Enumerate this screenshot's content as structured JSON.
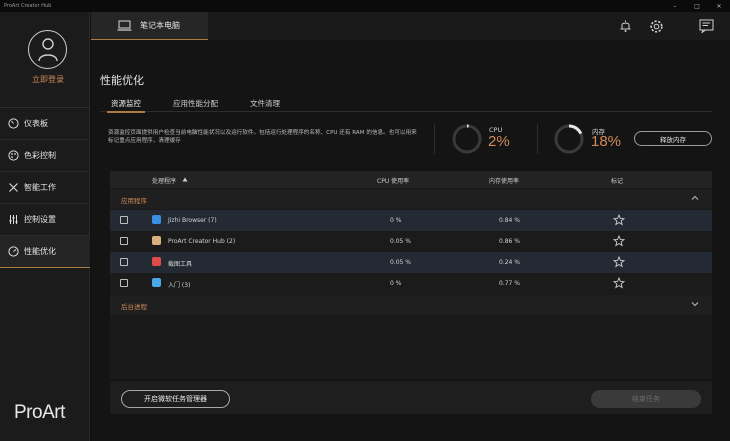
{
  "window": {
    "title": "ProArt Creator Hub",
    "controls": [
      "–",
      "□",
      "✕"
    ]
  },
  "sidebar": {
    "login_label": "立即登录",
    "items": [
      {
        "label": "仪表板",
        "icon": "gauge-icon"
      },
      {
        "label": "色彩控制",
        "icon": "palette-icon"
      },
      {
        "label": "智能工作",
        "icon": "tools-icon"
      },
      {
        "label": "控制设置",
        "icon": "sliders-icon"
      },
      {
        "label": "性能优化",
        "icon": "performance-icon",
        "active": true
      }
    ],
    "brand": "ProArt"
  },
  "header": {
    "device_tab": "笔记本电脑",
    "icons": [
      "bell-icon",
      "gear-icon",
      "feedback-icon"
    ]
  },
  "page": {
    "title": "性能优化",
    "tabs": [
      {
        "label": "资源监控",
        "active": true
      },
      {
        "label": "应用性能分配",
        "active": false
      },
      {
        "label": "文件清理",
        "active": false
      }
    ],
    "description": "资源监控页面提供用户检查当前电脑性能状况以及运行软件。包括运行处理程序的名称、CPU 还有 RAM 的信息。也可以用来标记重点应用程序，清理缓存"
  },
  "monitor": {
    "cpu": {
      "label": "CPU",
      "value": "2%",
      "fraction": 0.02
    },
    "memory": {
      "label": "内存",
      "value": "18%",
      "fraction": 0.18
    },
    "release_button": "释放内存"
  },
  "table": {
    "headers": {
      "process": "处理程序",
      "cpu": "CPU 使用率",
      "memory": "内存使用率",
      "mark": "标记"
    },
    "groups": {
      "apps": "应用程序",
      "background": "后台进程"
    },
    "rows": [
      {
        "name": "Jizhi Browser (7)",
        "cpu": "0 %",
        "memory": "0.84 %",
        "icon_color": "#3b8fe0"
      },
      {
        "name": "ProArt Creator Hub (2)",
        "cpu": "0.05 %",
        "memory": "0.86 %",
        "icon_color": "#d9b07a"
      },
      {
        "name": "截图工具",
        "cpu": "0.05 %",
        "memory": "0.24 %",
        "icon_color": "#e04a4a"
      },
      {
        "name": "入门 (3)",
        "cpu": "0 %",
        "memory": "0.77 %",
        "icon_color": "#4aa8e8"
      }
    ]
  },
  "footer": {
    "task_manager_button": "开启微软任务管理器",
    "end_task_button": "结束任务"
  },
  "colors": {
    "accent": "#d28a5a",
    "underline": "#b07a45",
    "background": "#141414"
  }
}
